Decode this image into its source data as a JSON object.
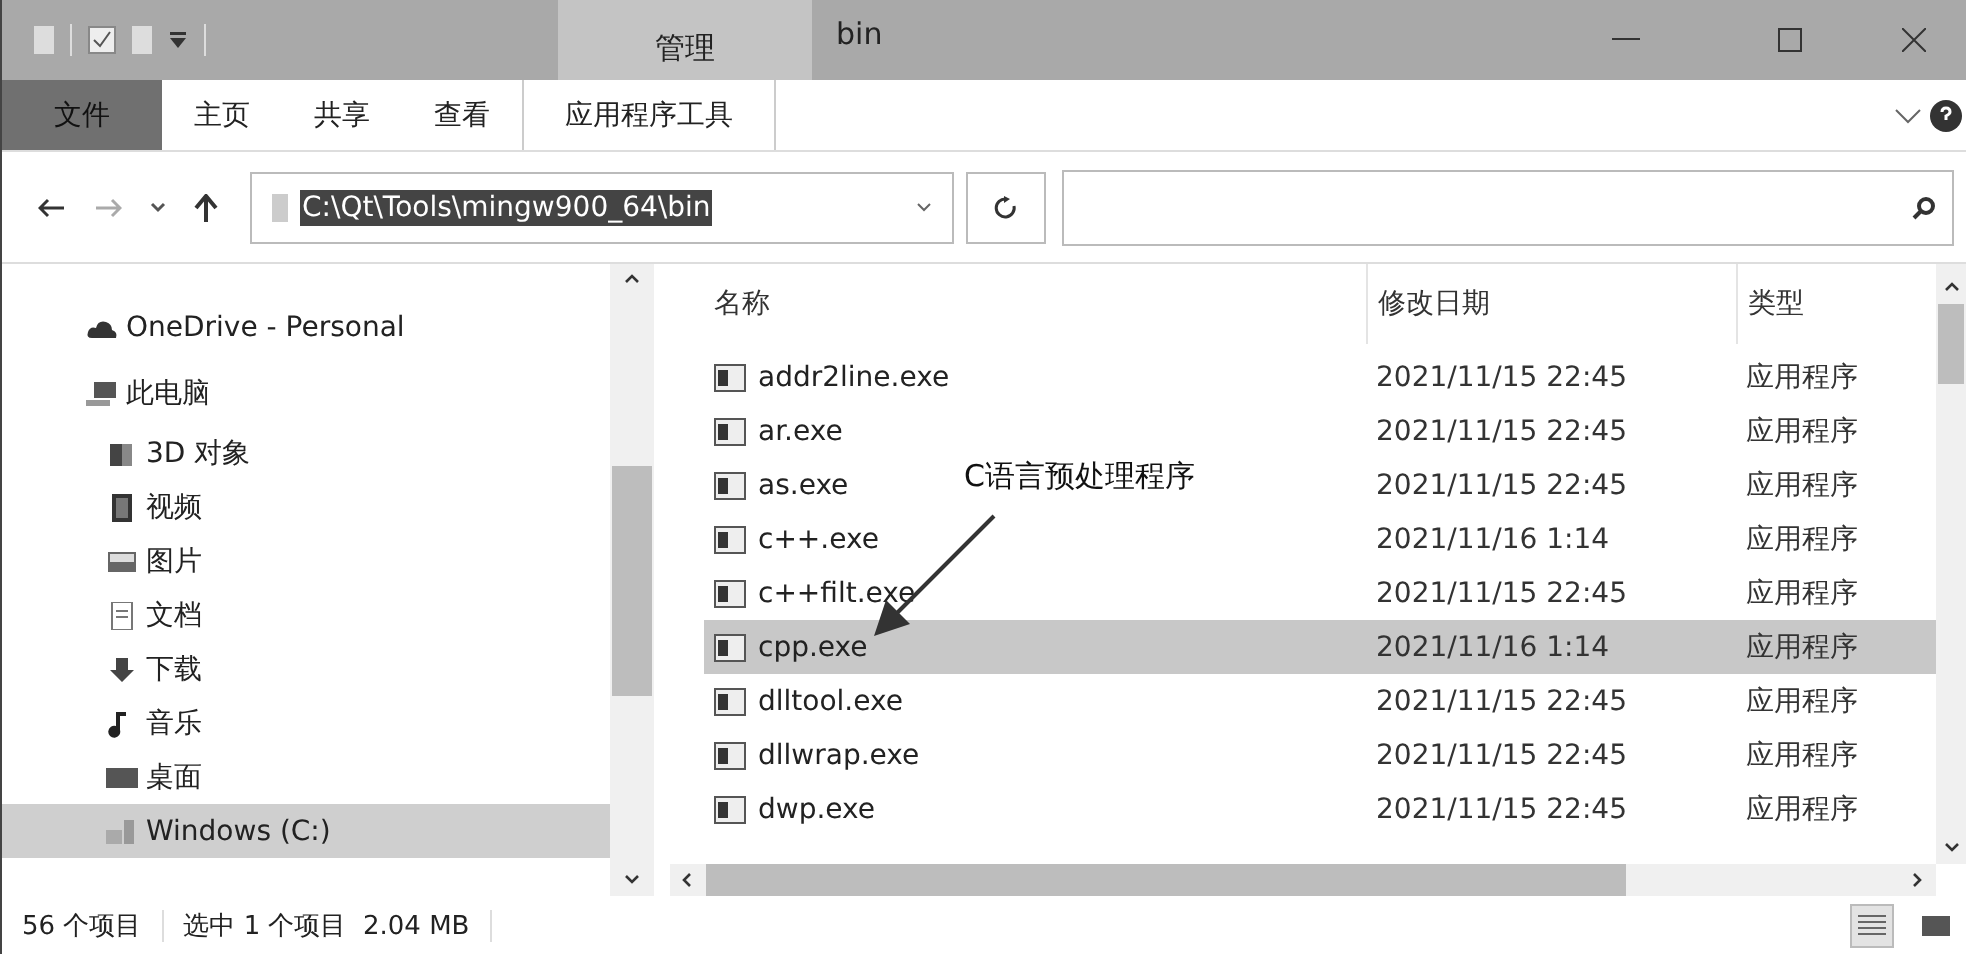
{
  "title_bar": {
    "context_tab": "管理",
    "title": "bin"
  },
  "ribbon": {
    "tabs": [
      {
        "label": "文件",
        "kind": "file",
        "selected": false
      },
      {
        "label": "主页",
        "kind": "tab",
        "selected": false
      },
      {
        "label": "共享",
        "kind": "tab",
        "selected": false
      },
      {
        "label": "查看",
        "kind": "tab",
        "selected": false
      },
      {
        "label": "应用程序工具",
        "kind": "context",
        "selected": false
      }
    ]
  },
  "address_bar": {
    "path": "C:\\Qt\\Tools\\mingw900_64\\bin"
  },
  "sidebar": {
    "items": [
      {
        "label": "OneDrive - Personal",
        "selected": false
      },
      {
        "label": "此电脑",
        "selected": false,
        "children": [
          {
            "label": "3D 对象",
            "selected": false
          },
          {
            "label": "视频",
            "selected": false
          },
          {
            "label": "图片",
            "selected": false
          },
          {
            "label": "文档",
            "selected": false
          },
          {
            "label": "下载",
            "selected": false
          },
          {
            "label": "音乐",
            "selected": false
          },
          {
            "label": "桌面",
            "selected": false
          },
          {
            "label": "Windows (C:)",
            "selected": true
          }
        ]
      }
    ]
  },
  "file_list": {
    "columns": [
      "名称",
      "修改日期",
      "类型"
    ],
    "rows": [
      {
        "name": "addr2line.exe",
        "modified": "2021/11/15 22:45",
        "type": "应用程序",
        "selected": false
      },
      {
        "name": "ar.exe",
        "modified": "2021/11/15 22:45",
        "type": "应用程序",
        "selected": false
      },
      {
        "name": "as.exe",
        "modified": "2021/11/15 22:45",
        "type": "应用程序",
        "selected": false
      },
      {
        "name": "c++.exe",
        "modified": "2021/11/16 1:14",
        "type": "应用程序",
        "selected": false
      },
      {
        "name": "c++filt.exe",
        "modified": "2021/11/15 22:45",
        "type": "应用程序",
        "selected": false
      },
      {
        "name": "cpp.exe",
        "modified": "2021/11/16 1:14",
        "type": "应用程序",
        "selected": true
      },
      {
        "name": "dlltool.exe",
        "modified": "2021/11/15 22:45",
        "type": "应用程序",
        "selected": false
      },
      {
        "name": "dllwrap.exe",
        "modified": "2021/11/15 22:45",
        "type": "应用程序",
        "selected": false
      },
      {
        "name": "dwp.exe",
        "modified": "2021/11/15 22:45",
        "type": "应用程序",
        "selected": false
      }
    ]
  },
  "annotation": {
    "text": "C语言预处理程序"
  },
  "status_bar": {
    "item_count": "56 个项目",
    "selection": "选中 1 个项目  2.04 MB"
  }
}
